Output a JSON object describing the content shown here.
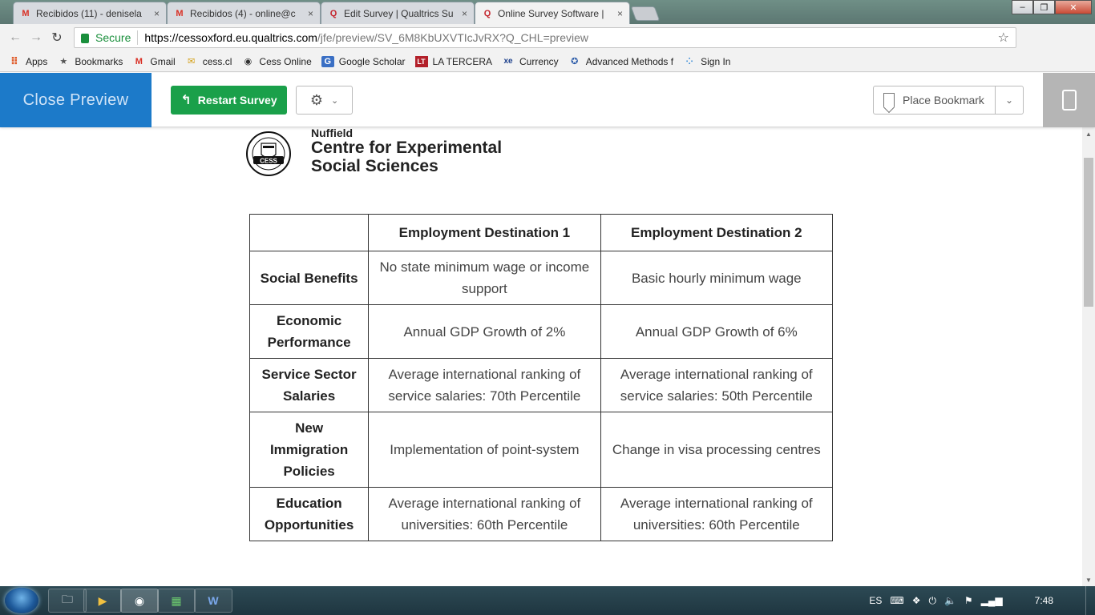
{
  "browser": {
    "tabs": [
      {
        "favicon": "gmail-icon",
        "title": "Recibidos (11) - denisela",
        "close": "×",
        "active": false
      },
      {
        "favicon": "gmail-icon",
        "title": "Recibidos (4) - online@c",
        "close": "×",
        "active": false
      },
      {
        "favicon": "qualtrics-icon",
        "title": "Edit Survey | Qualtrics Su",
        "close": "×",
        "active": false
      },
      {
        "favicon": "qualtrics-icon",
        "title": "Online Survey Software |",
        "close": "×",
        "active": true
      }
    ],
    "window_buttons": {
      "minimize": "–",
      "maximize": "❐",
      "close": "✕"
    },
    "nav": {
      "back": "←",
      "forward": "→",
      "reload": "↻"
    },
    "secure_label": "Secure",
    "url_host": "https://cessoxford.eu.qualtrics.com",
    "url_path": "/jfe/preview/SV_6M8KbUXVTIcJvRX?Q_CHL=preview",
    "bookmarks": [
      {
        "icon": "apps-grid-icon",
        "label": "Apps"
      },
      {
        "icon": "star-icon",
        "label": "Bookmarks"
      },
      {
        "icon": "gmail-icon",
        "label": "Gmail"
      },
      {
        "icon": "envelope-icon",
        "label": "cess.cl"
      },
      {
        "icon": "cess-icon",
        "label": "Cess Online"
      },
      {
        "icon": "google-scholar-icon",
        "label": "Google Scholar"
      },
      {
        "icon": "la-tercera-icon",
        "label": "LA TERCERA"
      },
      {
        "icon": "xe-icon",
        "label": "Currency"
      },
      {
        "icon": "advanced-methods-icon",
        "label": "Advanced Methods f"
      },
      {
        "icon": "sign-in-icon",
        "label": "Sign In"
      }
    ]
  },
  "preview_header": {
    "close_preview": "Close Preview",
    "restart_survey": "Restart Survey",
    "place_bookmark": "Place Bookmark"
  },
  "logo": {
    "line1": "Nuffield",
    "line2": "Centre for Experimental",
    "line3": "Social Sciences",
    "seal_text": "CESS"
  },
  "table": {
    "headers": [
      "",
      "Employment Destination 1",
      "Employment Destination 2"
    ],
    "rows": [
      {
        "attribute": "Social Benefits",
        "d1": "No state minimum wage or income support",
        "d2": "Basic hourly minimum wage"
      },
      {
        "attribute": "Economic Performance",
        "d1": "Annual GDP Growth of 2%",
        "d2": "Annual GDP Growth of 6%"
      },
      {
        "attribute": "Service Sector Salaries",
        "d1": "Average international ranking of service salaries: 70th Percentile",
        "d2": "Average international ranking of service salaries: 50th Percentile"
      },
      {
        "attribute": "New Immigration Policies",
        "d1": "Implementation of point-system",
        "d2": "Change in visa processing centres"
      },
      {
        "attribute": "Education Opportunities",
        "d1": "Average international ranking of universities: 60th Percentile",
        "d2": "Average international ranking of universities: 60th Percentile"
      }
    ]
  },
  "taskbar": {
    "language": "ES",
    "clock": "7:48"
  },
  "colors": {
    "close_preview_bg": "#1c7ac9",
    "restart_bg": "#1aa04a",
    "secure_green": "#1a8f3c"
  }
}
